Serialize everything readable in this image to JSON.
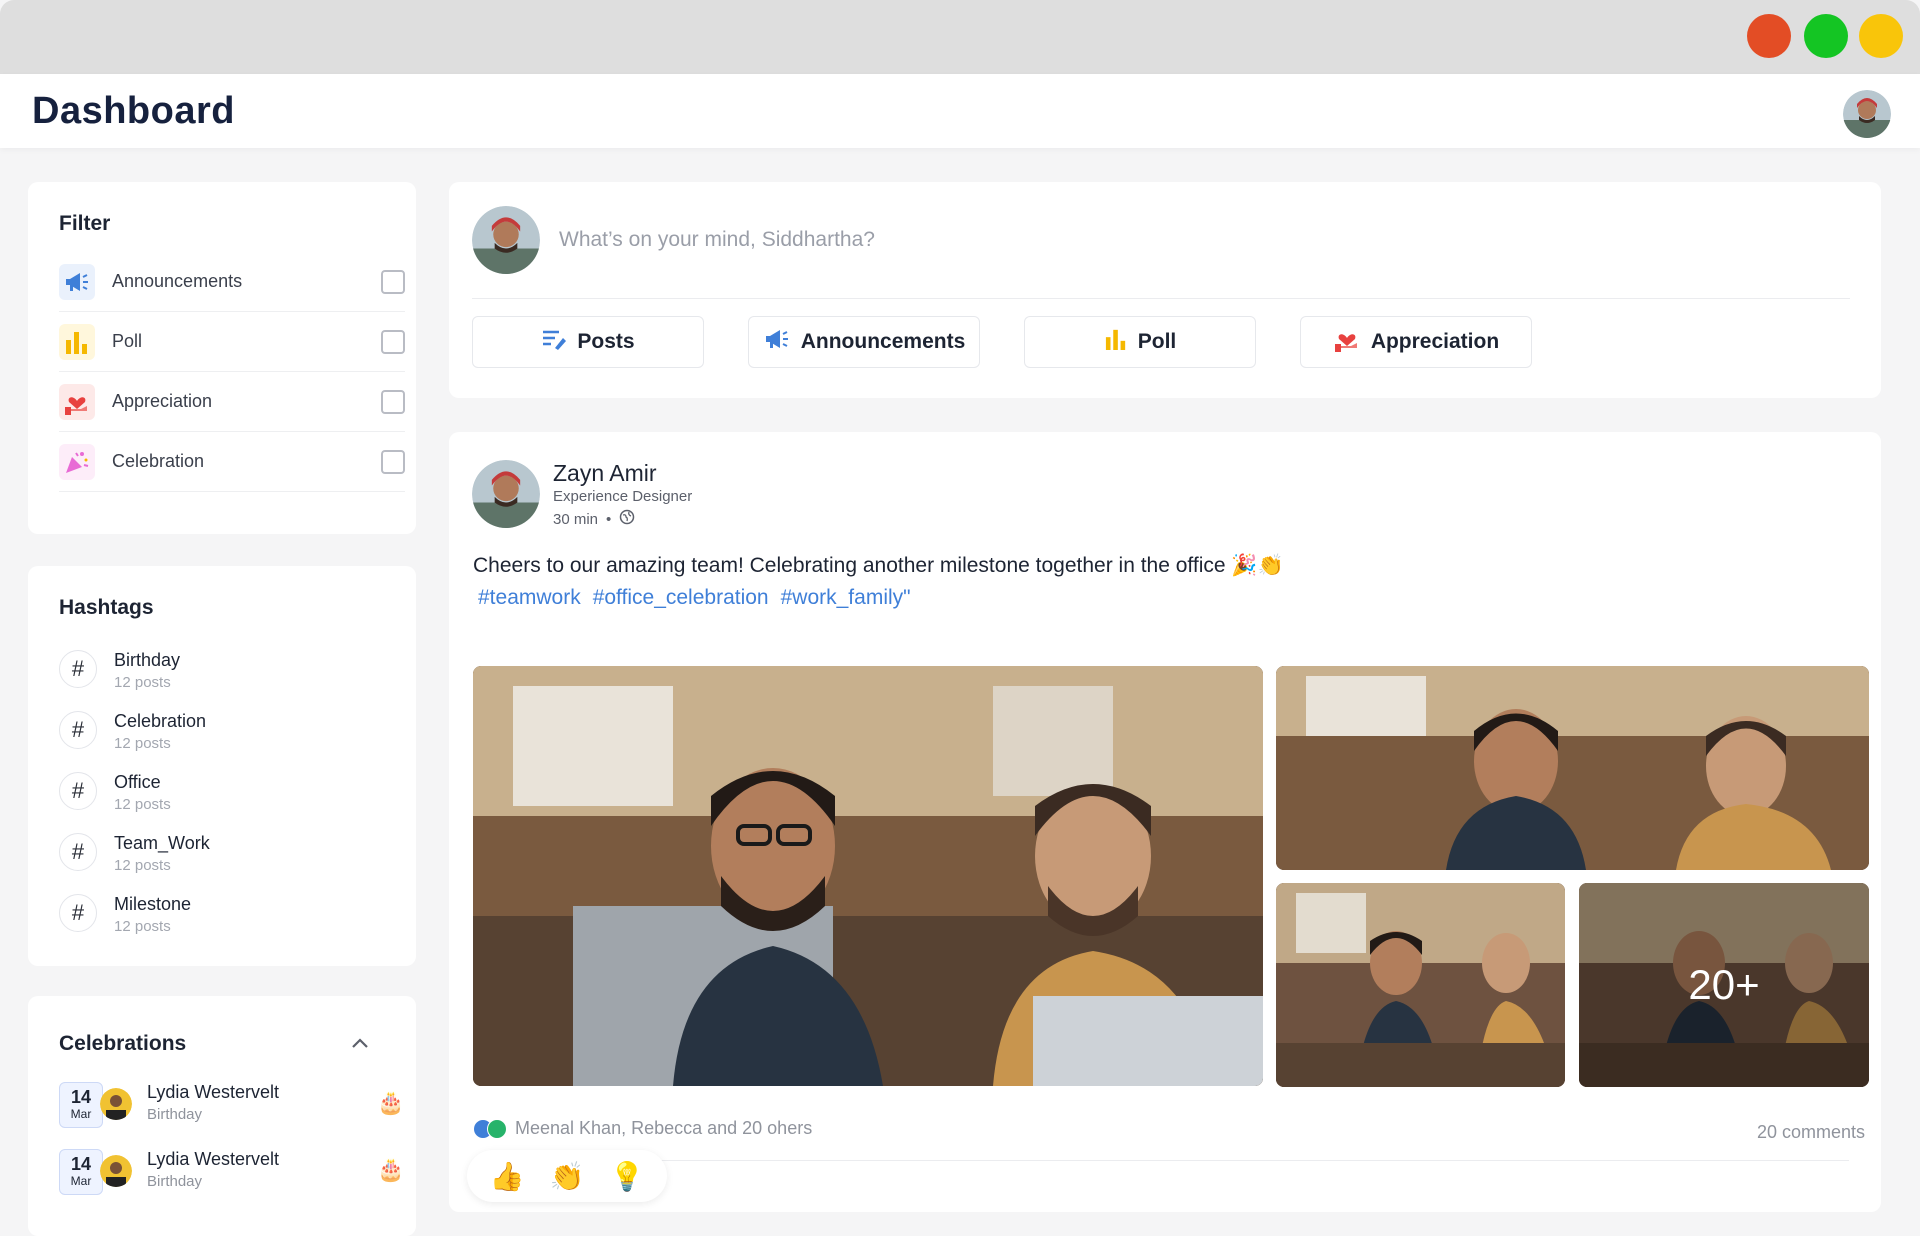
{
  "app": {
    "title": "Dashboard"
  },
  "filter": {
    "title": "Filter",
    "items": [
      {
        "label": "Announcements",
        "icon": "megaphone-icon",
        "color": "#3f7fd8",
        "checked": false
      },
      {
        "label": "Poll",
        "icon": "bar-chart-icon",
        "color": "#f5b800",
        "checked": false
      },
      {
        "label": "Appreciation",
        "icon": "hand-heart-icon",
        "color": "#e8413f",
        "checked": false
      },
      {
        "label": "Celebration",
        "icon": "party-popper-icon",
        "color": "#e86bd5",
        "checked": false
      }
    ]
  },
  "hashtags": {
    "title": "Hashtags",
    "items": [
      {
        "symbol": "#",
        "name": "Birthday",
        "count": "12 posts"
      },
      {
        "symbol": "#",
        "name": "Celebration",
        "count": "12 posts"
      },
      {
        "symbol": "#",
        "name": "Office",
        "count": "12 posts"
      },
      {
        "symbol": "#",
        "name": "Team_Work",
        "count": "12 posts"
      },
      {
        "symbol": "#",
        "name": "Milestone",
        "count": "12 posts"
      }
    ]
  },
  "celebrations": {
    "title": "Celebrations",
    "items": [
      {
        "day": "14",
        "month": "Mar",
        "name": "Lydia Westervelt",
        "type": "Birthday",
        "emoji": "🎂"
      },
      {
        "day": "14",
        "month": "Mar",
        "name": "Lydia Westervelt",
        "type": "Birthday",
        "emoji": "🎂"
      }
    ]
  },
  "composer": {
    "placeholder": "What’s on your mind, Siddhartha?",
    "buttons": [
      {
        "label": "Posts",
        "icon": "edit-lines-icon",
        "color": "#3f7fd8"
      },
      {
        "label": "Announcements",
        "icon": "megaphone-icon",
        "color": "#3f7fd8"
      },
      {
        "label": "Poll",
        "icon": "bar-chart-icon",
        "color": "#f5b800"
      },
      {
        "label": "Appreciation",
        "icon": "hand-heart-icon",
        "color": "#e8413f"
      }
    ]
  },
  "post": {
    "author": "Zayn Amir",
    "role": "Experience Designer",
    "time": "30 min",
    "separator": "•",
    "visibility_icon": "globe-icon",
    "text": "Cheers to our amazing team! Celebrating another milestone together in the office 🎉👏",
    "tags": [
      "#teamwork",
      "#office_celebration",
      "#work_family\""
    ],
    "more_photos": "20+",
    "reactions_summary": "Meenal Khan, Rebecca and 20 ohers",
    "comments": "20 comments",
    "reaction_options": [
      {
        "emoji": "👍",
        "name": "like"
      },
      {
        "emoji": "👏",
        "name": "clap"
      },
      {
        "emoji": "💡",
        "name": "insightful"
      }
    ]
  },
  "colors": {
    "accent": "#3f7fd8",
    "poll": "#f5b800",
    "appreciation": "#e8413f",
    "celebration": "#e86bd5",
    "window_red": "#e34d25",
    "window_green": "#14c523",
    "window_yellow": "#f9c50a"
  }
}
